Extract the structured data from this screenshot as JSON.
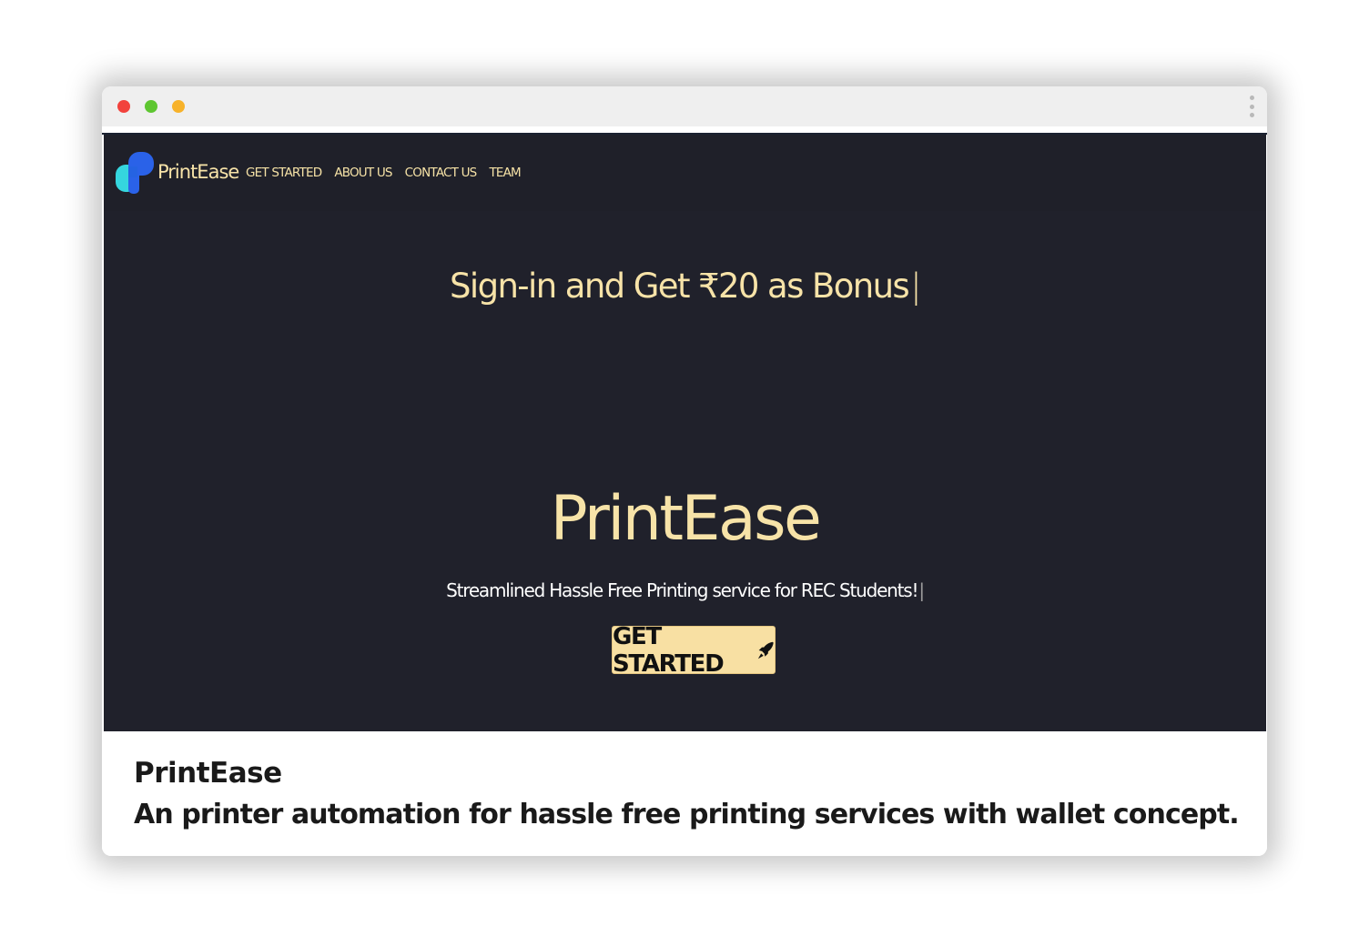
{
  "browser": {
    "controls": [
      "close",
      "maximize",
      "minimize"
    ],
    "menu_icon": "kebab-icon"
  },
  "navbar": {
    "brand": "PrintEase",
    "logo_icon": "printease-logo-icon",
    "links": [
      "GET STARTED",
      "ABOUT US",
      "CONTACT US",
      "TEAM"
    ]
  },
  "hero": {
    "bonus": "Sign-in and Get ₹20 as Bonus",
    "title": "PrintEase",
    "tagline": "Streamlined Hassle Free Printing service for REC Students!",
    "cta_label": "GET STARTED",
    "cta_icon": "rocket-icon"
  },
  "caption": {
    "title": "PrintEase",
    "description": "An printer automation for hassle free printing services with wallet concept."
  },
  "colors": {
    "background": "#20212b",
    "accent": "#f7e3a8",
    "cta": "#f8e0a3"
  }
}
